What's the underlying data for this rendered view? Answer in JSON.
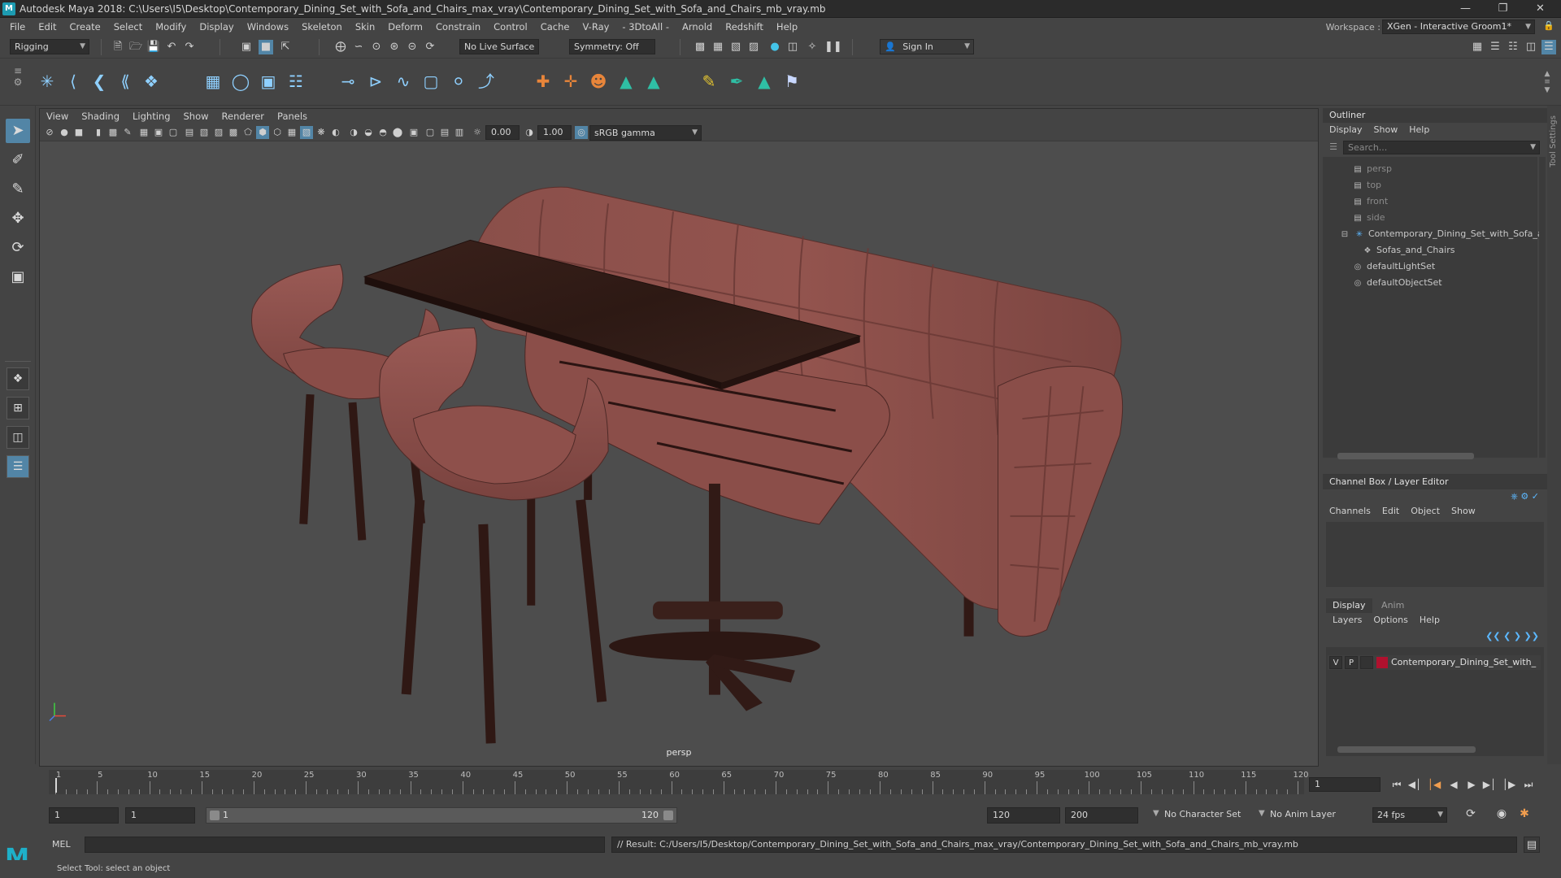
{
  "window": {
    "title": "Autodesk Maya 2018: C:\\Users\\I5\\Desktop\\Contemporary_Dining_Set_with_Sofa_and_Chairs_max_vray\\Contemporary_Dining_Set_with_Sofa_and_Chairs_mb_vray.mb",
    "logo_letter": "M"
  },
  "menubar": {
    "items": [
      "File",
      "Edit",
      "Create",
      "Select",
      "Modify",
      "Display",
      "Windows",
      "Skeleton",
      "Skin",
      "Deform",
      "Constrain",
      "Control",
      "Cache",
      "V-Ray",
      "- 3DtoAll -",
      "Arnold",
      "Redshift",
      "Help"
    ],
    "workspace_label": "Workspace :",
    "workspace_value": "XGen - Interactive Groom1*"
  },
  "statusline": {
    "mode": "Rigging",
    "live_surface": "No Live Surface",
    "symmetry": "Symmetry: Off",
    "sign_in": "Sign In"
  },
  "viewport": {
    "menus": [
      "View",
      "Shading",
      "Lighting",
      "Show",
      "Renderer",
      "Panels"
    ],
    "exposure": "0.00",
    "gamma": "1.00",
    "color_space": "sRGB gamma",
    "camera_label": "persp"
  },
  "outliner": {
    "title": "Outliner",
    "menus": [
      "Display",
      "Show",
      "Help"
    ],
    "search_placeholder": "Search...",
    "items": [
      {
        "label": "persp",
        "icon": "camera-icon",
        "dim": true
      },
      {
        "label": "top",
        "icon": "camera-icon",
        "dim": true
      },
      {
        "label": "front",
        "icon": "camera-icon",
        "dim": true
      },
      {
        "label": "side",
        "icon": "camera-icon",
        "dim": true
      },
      {
        "label": "Contemporary_Dining_Set_with_Sofa_a",
        "icon": "group-icon",
        "dim": false
      },
      {
        "label": "Sofas_and_Chairs",
        "icon": "mesh-icon",
        "dim": false
      },
      {
        "label": "defaultLightSet",
        "icon": "set-icon",
        "dim": false
      },
      {
        "label": "defaultObjectSet",
        "icon": "set-icon",
        "dim": false
      }
    ]
  },
  "channelbox": {
    "title": "Channel Box / Layer Editor",
    "menus": [
      "Channels",
      "Edit",
      "Object",
      "Show"
    ],
    "tabs": [
      "Display",
      "Anim"
    ],
    "layer_menus": [
      "Layers",
      "Options",
      "Help"
    ],
    "layer": {
      "v": "V",
      "p": "P",
      "name": "Contemporary_Dining_Set_with_",
      "color": "#b0112e"
    }
  },
  "toolsettings_label": "Tool Settings",
  "timeslider": {
    "ticks": [
      "1",
      "5",
      "10",
      "15",
      "20",
      "25",
      "30",
      "35",
      "40",
      "45",
      "50",
      "55",
      "60",
      "65",
      "70",
      "75",
      "80",
      "85",
      "90",
      "95",
      "100",
      "105",
      "110",
      "115",
      "120"
    ],
    "current_frame": "1"
  },
  "range": {
    "start": "1",
    "inner_start": "1",
    "slider_start": "1",
    "slider_end": "120",
    "end": "120",
    "outer_end": "200",
    "character_set": "No Character Set",
    "anim_layer": "No Anim Layer",
    "fps": "24 fps"
  },
  "commandline": {
    "mode": "MEL",
    "result": "// Result: C:/Users/I5/Desktop/Contemporary_Dining_Set_with_Sofa_and_Chairs_max_vray/Contemporary_Dining_Set_with_Sofa_and_Chairs_mb_vray.mb"
  },
  "helpline": "Select Tool: select an object"
}
